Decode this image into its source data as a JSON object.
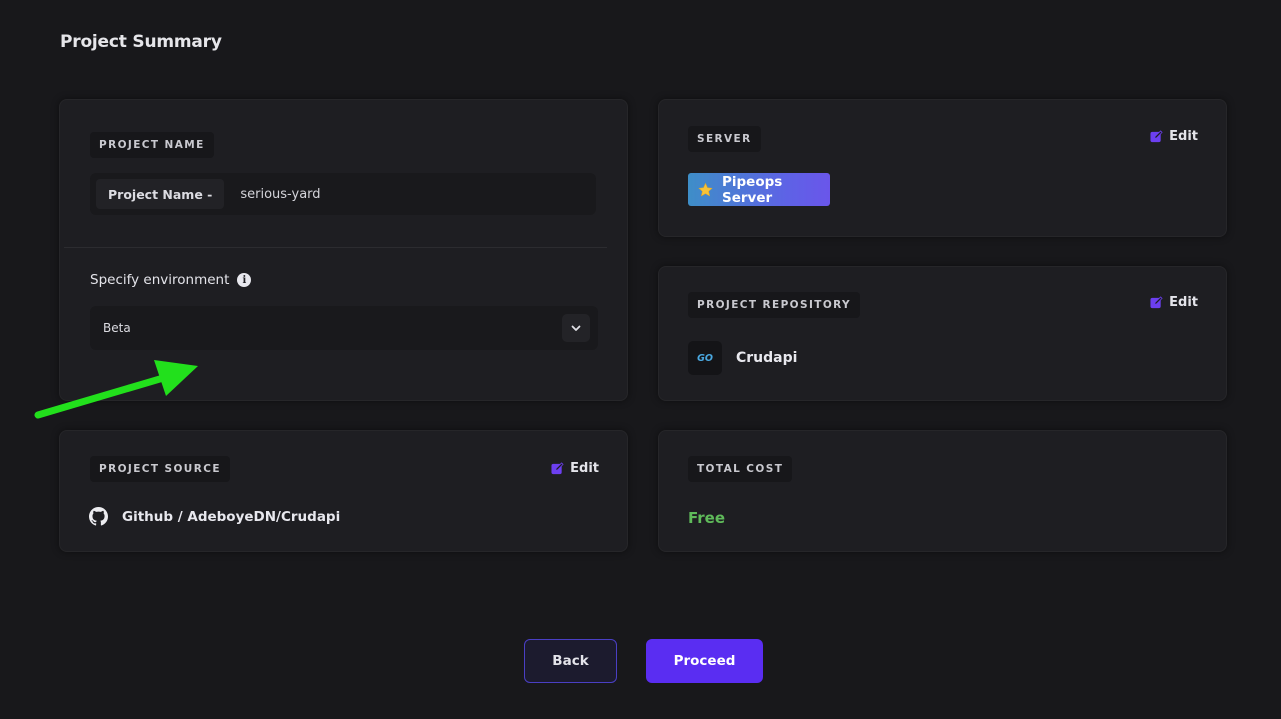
{
  "page": {
    "title": "Project Summary"
  },
  "project_name": {
    "heading": "PROJECT NAME",
    "label": "Project Name -",
    "value": "serious-yard"
  },
  "environment": {
    "label": "Specify environment",
    "info_icon": "info-icon",
    "selected": "Beta"
  },
  "server": {
    "heading": "SERVER",
    "edit_label": "Edit",
    "badge_label": "Pipeops Server",
    "badge_icon": "star-icon"
  },
  "repository": {
    "heading": "PROJECT REPOSITORY",
    "edit_label": "Edit",
    "logo_text": "GO",
    "name": "Crudapi"
  },
  "source": {
    "heading": "PROJECT SOURCE",
    "edit_label": "Edit",
    "icon": "github-icon",
    "value": "Github / AdeboyeDN/Crudapi"
  },
  "cost": {
    "heading": "TOTAL COST",
    "value": "Free"
  },
  "actions": {
    "back_label": "Back",
    "proceed_label": "Proceed"
  },
  "colors": {
    "accent": "#5a2df2",
    "edit_icon": "#6c3ff0",
    "free_green": "#5fba5a",
    "annotation_arrow": "#22e01c"
  }
}
